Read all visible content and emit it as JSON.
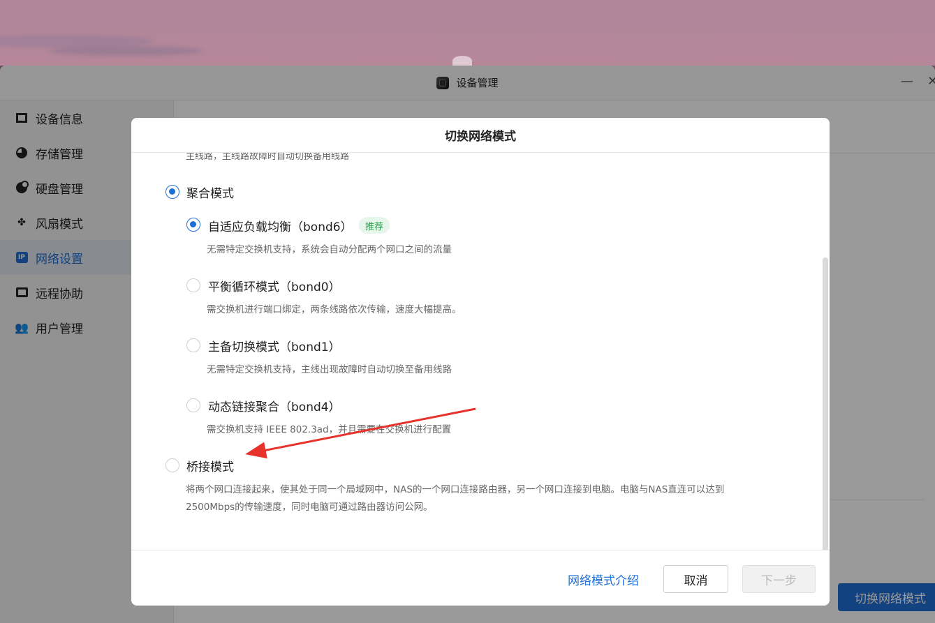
{
  "window": {
    "title": "设备管理",
    "minimize_glyph": "—",
    "close_glyph": "✕"
  },
  "sidebar": {
    "items": [
      {
        "label": "设备信息",
        "icon": "device-info-icon"
      },
      {
        "label": "存储管理",
        "icon": "storage-pie-icon"
      },
      {
        "label": "硬盘管理",
        "icon": "disk-icon"
      },
      {
        "label": "风扇模式",
        "icon": "fan-icon"
      },
      {
        "label": "网络设置",
        "icon": "ip-icon",
        "active": true
      },
      {
        "label": "远程协助",
        "icon": "remote-icon"
      },
      {
        "label": "用户管理",
        "icon": "users-icon"
      }
    ]
  },
  "background": {
    "switch_button_label": "切换网络模式"
  },
  "modal": {
    "title": "切换网络模式",
    "cut_text": "主线路，主线路故障时自动切换备用线路",
    "aggregate": {
      "label": "聚合模式",
      "checked": true,
      "options": [
        {
          "label": "自适应负载均衡（bond6）",
          "desc": "无需特定交换机支持，系统会自动分配两个网口之间的流量",
          "checked": true,
          "badge": "推荐"
        },
        {
          "label": "平衡循环模式（bond0）",
          "desc": "需交换机进行端口绑定，两条线路依次传输，速度大幅提高。",
          "checked": false
        },
        {
          "label": "主备切换模式（bond1）",
          "desc": "无需特定交换机支持，主线出现故障时自动切换至备用线路",
          "checked": false
        },
        {
          "label": "动态链接聚合（bond4）",
          "desc": "需交换机支持 IEEE 802.3ad，并且需要在交换机进行配置",
          "checked": false
        }
      ]
    },
    "bridge": {
      "label": "桥接模式",
      "checked": false,
      "desc_line1": "将两个网口连接起来，使其处于同一个局域网中，NAS的一个网口连接路由器，另一个网口连接到电脑。电脑与NAS直连可以达到",
      "desc_line2": "2500Mbps的传输速度，同时电脑可通过路由器访问公网。"
    },
    "footer": {
      "intro_link": "网络模式介绍",
      "cancel": "取消",
      "next": "下一步"
    }
  },
  "colors": {
    "accent": "#1f6fd6",
    "badge_bg": "#e6f6ea",
    "badge_text": "#27a04a",
    "annotation_arrow": "#e8322c"
  }
}
